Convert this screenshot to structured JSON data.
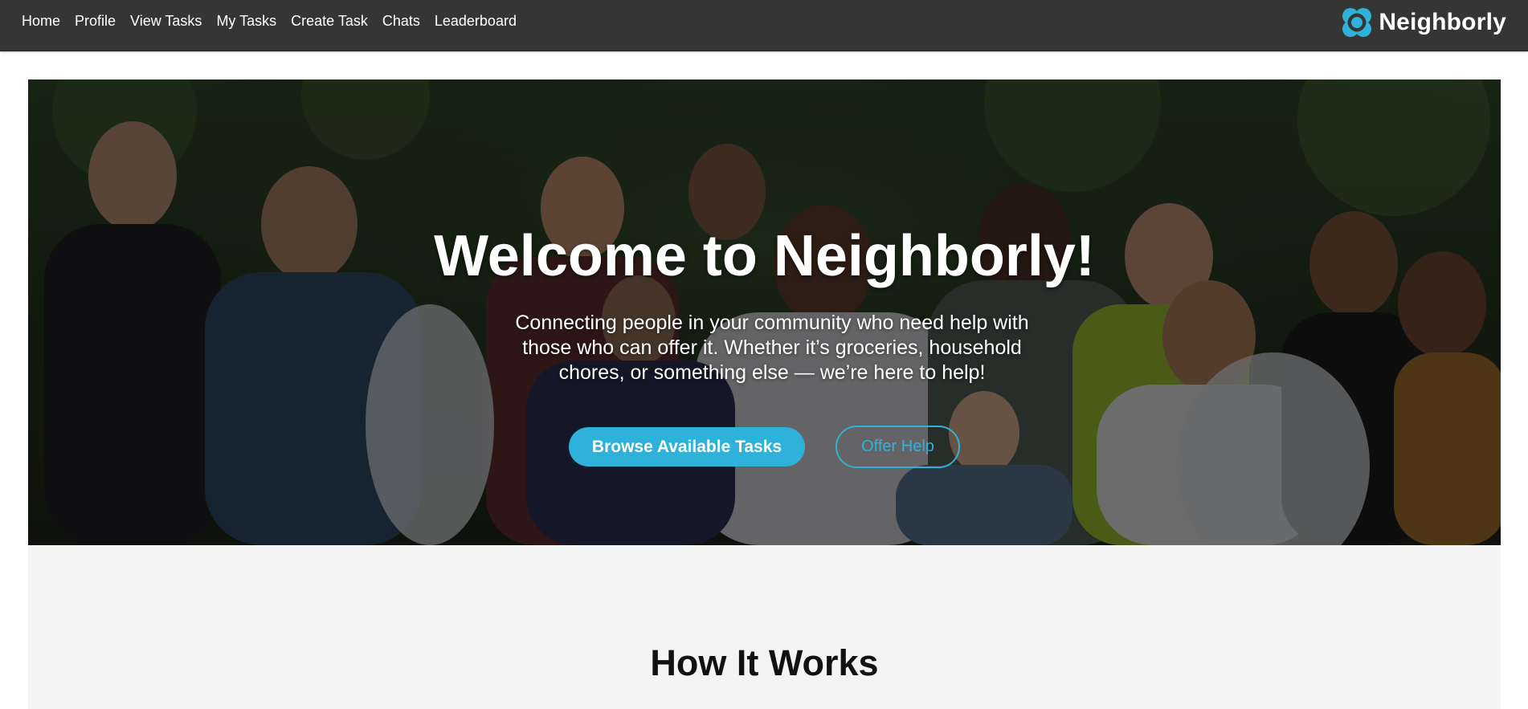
{
  "nav": {
    "links": [
      "Home",
      "Profile",
      "View Tasks",
      "My Tasks",
      "Create Task",
      "Chats",
      "Leaderboard"
    ],
    "brand": "Neighborly",
    "brand_icon": "neighborly-logo-icon"
  },
  "hero": {
    "title": "Welcome to Neighborly!",
    "subtitle": "Connecting people in your community who need help with those who can offer it. Whether it’s groceries, household chores, or something else — we’re here to help!",
    "primary_button": "Browse Available Tasks",
    "secondary_button": "Offer Help"
  },
  "how_it_works": {
    "title": "How It Works"
  },
  "colors": {
    "nav_bg": "#353535",
    "accent": "#2fb2d9",
    "section_bg": "#f4f4f4"
  }
}
